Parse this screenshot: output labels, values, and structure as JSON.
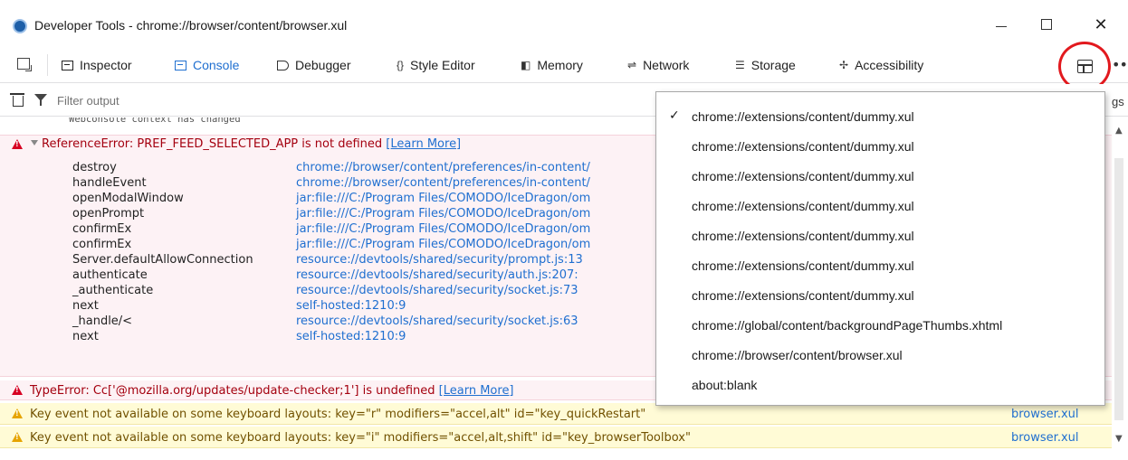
{
  "window": {
    "title": "Developer Tools - chrome://browser/content/browser.xul",
    "close_glyph": "✕"
  },
  "toolbar": {
    "tools": [
      {
        "label": "Inspector",
        "icon": "inspector-icon"
      },
      {
        "label": "Console",
        "icon": "console-icon",
        "active": true
      },
      {
        "label": "Debugger",
        "icon": "debugger-icon"
      },
      {
        "label": "Style Editor",
        "icon": "style-editor-icon",
        "glyph": "{}"
      },
      {
        "label": "Memory",
        "icon": "memory-icon",
        "glyph": "◧"
      },
      {
        "label": "Network",
        "icon": "network-icon",
        "glyph": "⇌"
      },
      {
        "label": "Storage",
        "icon": "storage-icon",
        "glyph": "☰"
      },
      {
        "label": "Accessibility",
        "icon": "accessibility-icon",
        "glyph": "✢"
      }
    ],
    "frame_select_icon": "frame-select-icon",
    "overflow_glyph": "•••",
    "accent_color": "#1f6fd0",
    "highlight_color": "#e2191e"
  },
  "filter": {
    "placeholder": "Filter output",
    "settings_partial": "gs"
  },
  "console": {
    "cut_off_line": "Webconsole context has changed",
    "error1": {
      "prefix": "ReferenceError: PREF_FEED_SELECTED_APP is not defined",
      "learn_more": "[Learn More]"
    },
    "stack": [
      {
        "fn": "destroy",
        "loc": "chrome://browser/content/preferences/in-content/"
      },
      {
        "fn": "handleEvent",
        "loc": "chrome://browser/content/preferences/in-content/"
      },
      {
        "fn": "openModalWindow",
        "loc": "jar:file:///C:/Program Files/COMODO/IceDragon/om"
      },
      {
        "fn": "openPrompt",
        "loc": "jar:file:///C:/Program Files/COMODO/IceDragon/om"
      },
      {
        "fn": "confirmEx",
        "loc": "jar:file:///C:/Program Files/COMODO/IceDragon/om"
      },
      {
        "fn": "confirmEx",
        "loc": "jar:file:///C:/Program Files/COMODO/IceDragon/om"
      },
      {
        "fn": "Server.defaultAllowConnection",
        "loc": "resource://devtools/shared/security/prompt.js:13"
      },
      {
        "fn": "authenticate",
        "loc": "resource://devtools/shared/security/auth.js:207:"
      },
      {
        "fn": "_authenticate",
        "loc": "resource://devtools/shared/security/socket.js:73"
      },
      {
        "fn": "next",
        "loc": "self-hosted:1210:9"
      },
      {
        "fn": "_handle/<",
        "loc": "resource://devtools/shared/security/socket.js:63"
      },
      {
        "fn": "next",
        "loc": "self-hosted:1210:9"
      }
    ],
    "error2": {
      "text": "TypeError: Cc['@mozilla.org/updates/update-checker;1'] is undefined",
      "learn_more": "[Learn More]"
    },
    "warnings": [
      {
        "text": "Key event not available on some keyboard layouts: key=\"r\" modifiers=\"accel,alt\" id=\"key_quickRestart\"",
        "source": "browser.xul"
      },
      {
        "text": "Key event not available on some keyboard layouts: key=\"i\" modifiers=\"accel,alt,shift\" id=\"key_browserToolbox\"",
        "source": "browser.xul"
      }
    ],
    "error_color": "#a4000f",
    "warning_color": "#715100"
  },
  "frame_menu": {
    "items": [
      {
        "label": "chrome://extensions/content/dummy.xul",
        "checked": true
      },
      {
        "label": "chrome://extensions/content/dummy.xul",
        "checked": false
      },
      {
        "label": "chrome://extensions/content/dummy.xul",
        "checked": false
      },
      {
        "label": "chrome://extensions/content/dummy.xul",
        "checked": false
      },
      {
        "label": "chrome://extensions/content/dummy.xul",
        "checked": false
      },
      {
        "label": "chrome://extensions/content/dummy.xul",
        "checked": false
      },
      {
        "label": "chrome://extensions/content/dummy.xul",
        "checked": false
      },
      {
        "label": "chrome://global/content/backgroundPageThumbs.xhtml",
        "checked": false
      },
      {
        "label": "chrome://browser/content/browser.xul",
        "checked": false
      },
      {
        "label": "about:blank",
        "checked": false
      }
    ],
    "check_glyph": "✓"
  }
}
